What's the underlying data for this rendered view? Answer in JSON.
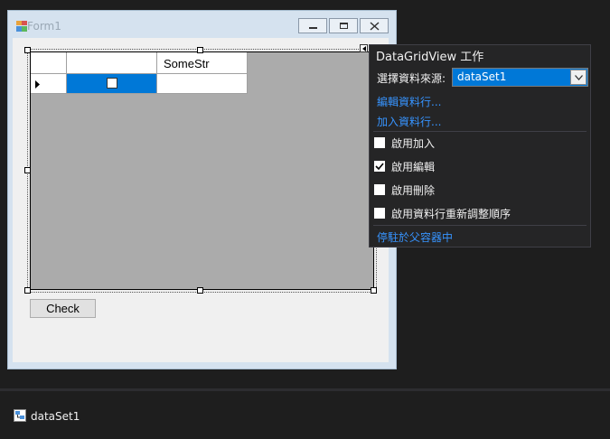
{
  "form": {
    "title": "Form1",
    "grid": {
      "columns": [
        "",
        "",
        "SomeStr"
      ],
      "row_indicator": "current-row-arrow"
    },
    "check_label": "Check"
  },
  "smart_tag": {
    "title": "DataGridView 工作",
    "source_label": "選擇資料來源:",
    "source_value": "dataSet1",
    "edit_columns": "編輯資料行...",
    "add_column": "加入資料行...",
    "options": [
      {
        "label": "啟用加入",
        "checked": false
      },
      {
        "label": "啟用編輯",
        "checked": true
      },
      {
        "label": "啟用刪除",
        "checked": false
      },
      {
        "label": "啟用資料行重新調整順序",
        "checked": false
      }
    ],
    "dock_link": "停駐於父容器中"
  },
  "tray": {
    "component": "dataSet1"
  },
  "colors": {
    "ide_bg": "#1e1e1e",
    "selection": "#0078d7",
    "link": "#3794ff"
  }
}
